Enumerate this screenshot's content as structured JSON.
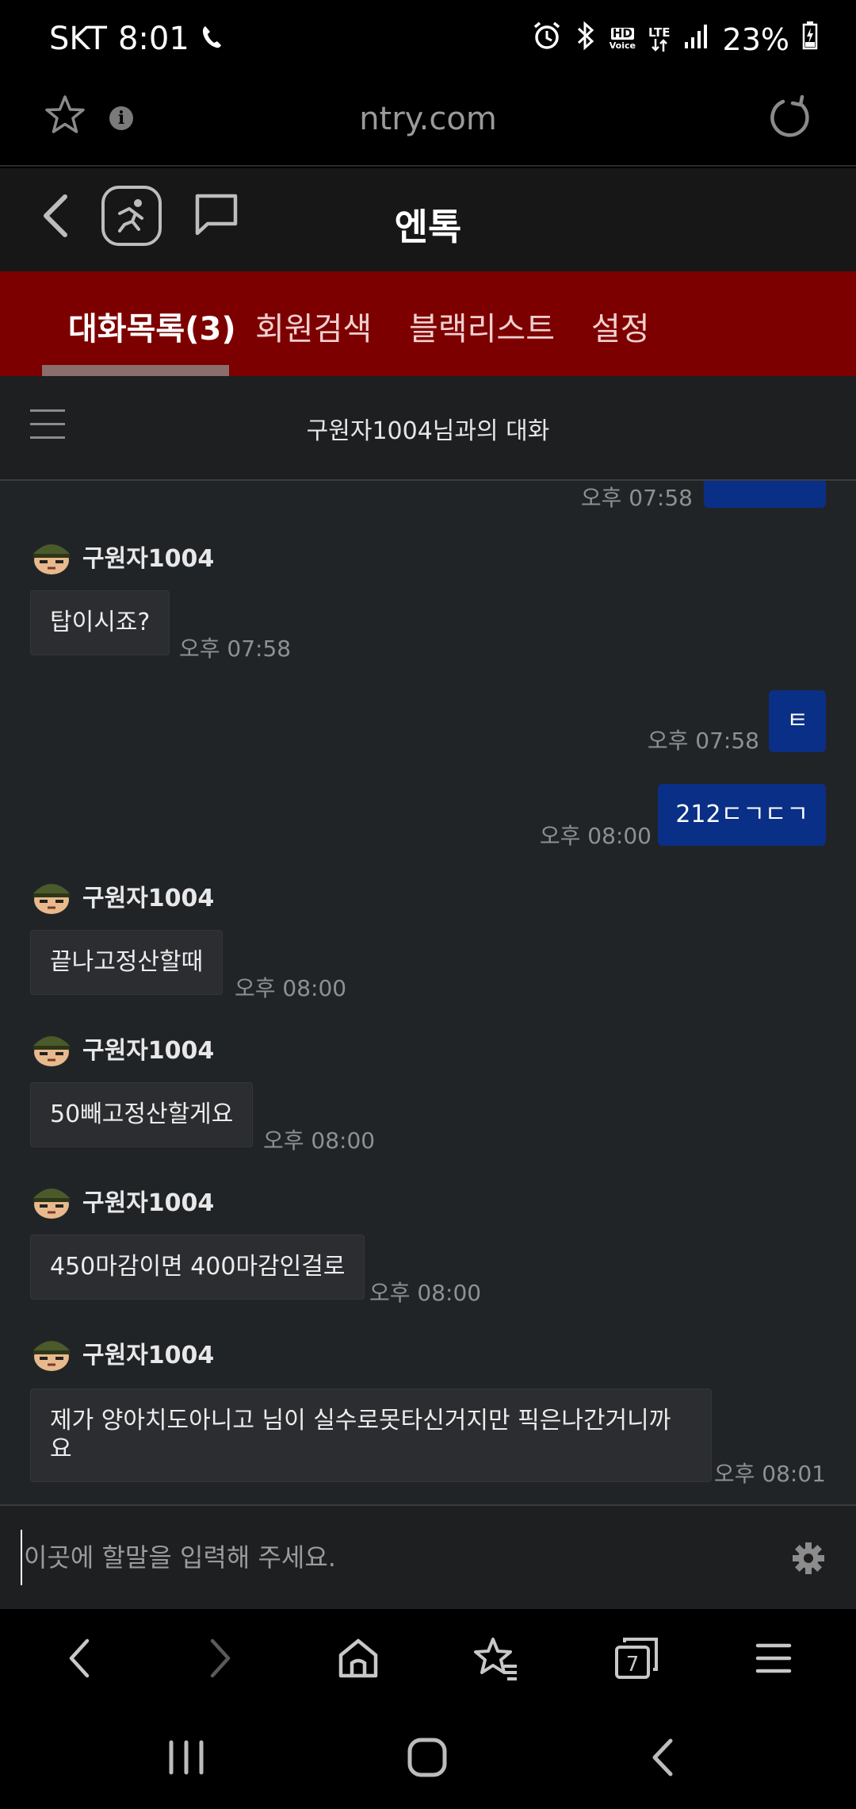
{
  "status_bar": {
    "carrier": "SKT",
    "time": "8:01",
    "network_hd": "HD",
    "network_voice": "Voice",
    "network_lte": "LTE",
    "battery": "23%"
  },
  "browser": {
    "url": "ntry.com"
  },
  "site_header": {
    "title": "엔톡"
  },
  "tabs": [
    {
      "label": "대화목록(3)",
      "active": true
    },
    {
      "label": "회원검색",
      "active": false
    },
    {
      "label": "블랙리스트",
      "active": false
    },
    {
      "label": "설정",
      "active": false
    }
  ],
  "conversation": {
    "title": "구원자1004님과의 대화"
  },
  "messages": [
    {
      "direction": "out",
      "time": "오후 07:58",
      "text": ""
    },
    {
      "direction": "in",
      "sender": "구원자1004",
      "text": "탑이시죠?",
      "time": "오후 07:58"
    },
    {
      "direction": "out",
      "text": "ㅌ",
      "time": "오후 07:58"
    },
    {
      "direction": "out",
      "text": "212ㄷㄱㄷㄱ",
      "time": "오후 08:00"
    },
    {
      "direction": "in",
      "sender": "구원자1004",
      "text": "끝나고정산할때",
      "time": "오후 08:00"
    },
    {
      "direction": "in",
      "sender": "구원자1004",
      "text": "50빼고정산할게요",
      "time": "오후 08:00"
    },
    {
      "direction": "in",
      "sender": "구원자1004",
      "text": "450마감이면 400마감인걸로",
      "time": "오후 08:00"
    },
    {
      "direction": "in",
      "sender": "구원자1004",
      "text": "제가 양아치도아니고 님이 실수로못타신거지만 픽은나간거니까요",
      "time": "오후 08:01"
    }
  ],
  "input": {
    "placeholder": "이곳에 할말을 입력해 주세요."
  },
  "browser_nav": {
    "tab_count": "7"
  }
}
